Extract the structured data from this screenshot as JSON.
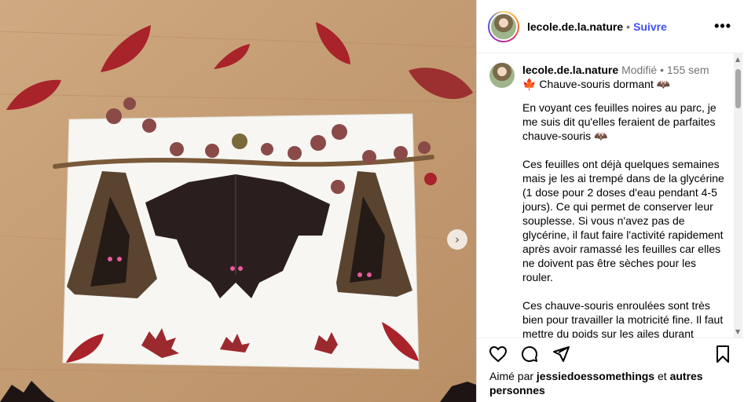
{
  "header": {
    "username": "lecole.de.la.nature",
    "separator": "•",
    "follow_label": "Suivre",
    "more_label": "•••"
  },
  "caption": {
    "username": "lecole.de.la.nature",
    "edited_label": "Modifié",
    "separator": "•",
    "time": "155 sem",
    "title_emoji_left": "🍁",
    "title": "Chauve-souris dormant",
    "title_emoji_right": "🦇",
    "paragraph1": "En voyant ces feuilles noires au parc, je me suis dit qu'elles feraient de parfaites chauve-souris",
    "paragraph1_emoji": "🦇",
    "paragraph2": "Ces feuilles ont déjà quelques semaines mais je les ai trempé dans de la glycérine (1 dose pour 2 doses d'eau pendant 4-5 jours). Ce qui permet de conserver leur souplesse. Si vous n'avez pas de glycérine, il faut faire l'activité rapidement après avoir ramassé les feuilles car elles ne doivent pas être sèches pour les rouler.",
    "paragraph3": "Ces chauve-souris enroulées sont très bien pour travailler la motricité fine. Il faut mettre du poids sur les ailes durant"
  },
  "media": {
    "next_label": "›"
  },
  "likes": {
    "prefix": "Aimé par",
    "user": "jessiedoessomethings",
    "conjunction": "et",
    "others": "autres personnes"
  },
  "icons": [
    "heart-icon",
    "comment-icon",
    "share-icon",
    "bookmark-icon",
    "chevron-right-icon",
    "more-icon"
  ],
  "colors": {
    "follow": "#4150f7",
    "muted": "#737373",
    "table_wood": "#c9a27a",
    "red_leaf": "#a8232a"
  }
}
